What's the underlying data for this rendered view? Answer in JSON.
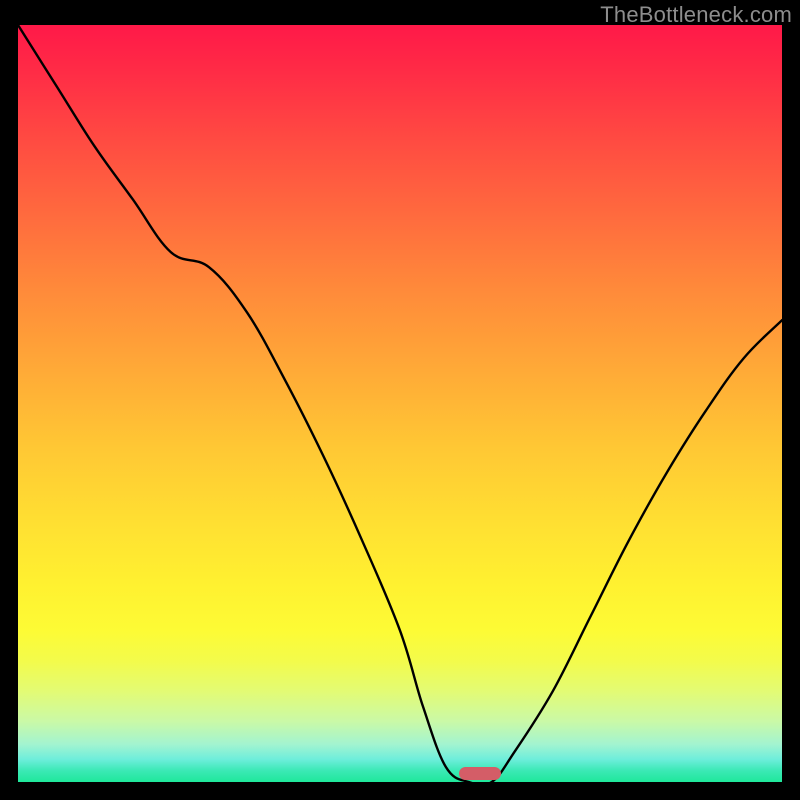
{
  "watermark": "TheBottleneck.com",
  "chart_data": {
    "type": "line",
    "title": "",
    "xlabel": "",
    "ylabel": "",
    "xlim": [
      0,
      100
    ],
    "ylim": [
      0,
      100
    ],
    "series": [
      {
        "name": "bottleneck-curve",
        "x": [
          0,
          5,
          10,
          15,
          20,
          25,
          30,
          35,
          40,
          45,
          50,
          53,
          56,
          59,
          62,
          65,
          70,
          75,
          80,
          85,
          90,
          95,
          100
        ],
        "y": [
          100,
          92,
          84,
          77,
          70,
          68,
          62,
          53,
          43,
          32,
          20,
          10,
          2,
          0,
          0,
          4,
          12,
          22,
          32,
          41,
          49,
          56,
          61
        ]
      }
    ],
    "marker": {
      "x_center": 60.5,
      "y": 0,
      "width": 5.5
    },
    "background_gradient": {
      "top": "#ff1948",
      "mid": "#ffe032",
      "bottom": "#1fe89b"
    }
  }
}
